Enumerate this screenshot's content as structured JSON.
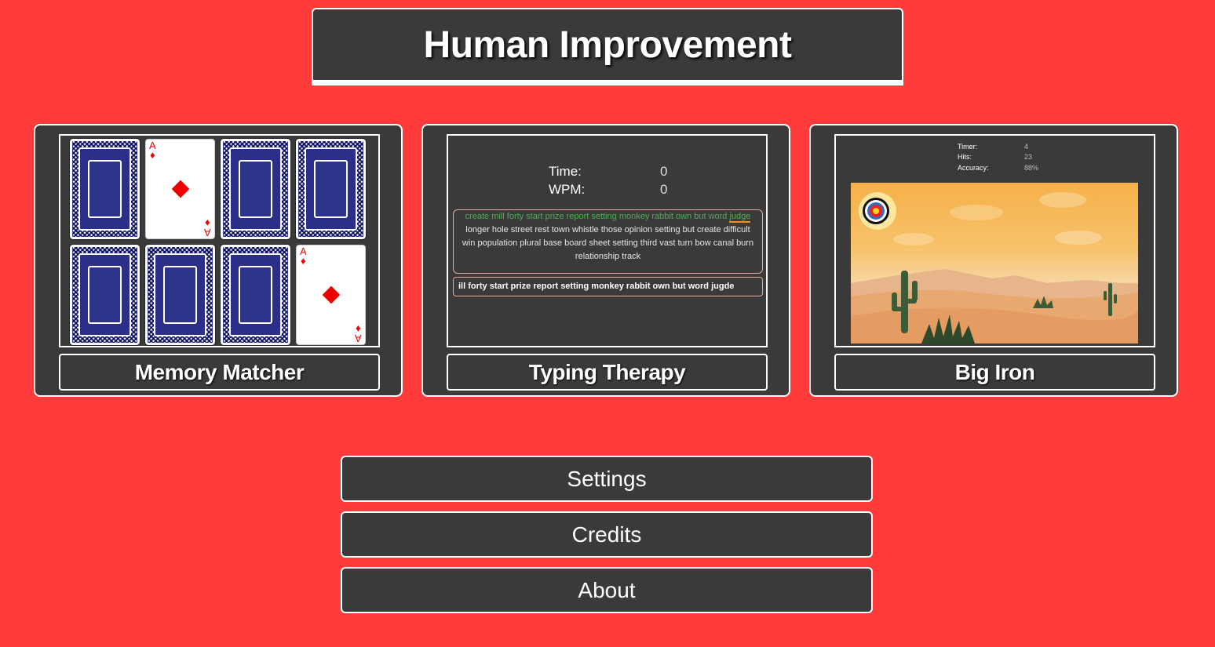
{
  "title": "Human Improvement",
  "games": [
    {
      "label": "Memory Matcher"
    },
    {
      "label": "Typing Therapy"
    },
    {
      "label": "Big Iron"
    }
  ],
  "memory": {
    "card_rank": "A",
    "card_suit_symbol": "♦"
  },
  "typing": {
    "time_label": "Time:",
    "time_value": "0",
    "wpm_label": "WPM:",
    "wpm_value": "0",
    "passage_done": "create mill forty start prize report setting monkey rabbit own but word",
    "passage_current": "judge",
    "passage_rest": "longer hole street rest town whistle those opinion setting but create difficult win population plural base board sheet setting third vast turn bow canal burn relationship track",
    "typed": "ill forty start prize report setting monkey rabbit own but word jugde"
  },
  "big_iron": {
    "timer_label": "Timer:",
    "timer_value": "4",
    "hits_label": "Hits:",
    "hits_value": "23",
    "accuracy_label": "Accuracy:",
    "accuracy_value": "88%"
  },
  "menu": {
    "settings": "Settings",
    "credits": "Credits",
    "about": "About"
  },
  "colors": {
    "background": "#ff3b3b",
    "panel": "#3a3a3a",
    "card_back": "#2b2f8a",
    "suit_red": "#e00000"
  }
}
